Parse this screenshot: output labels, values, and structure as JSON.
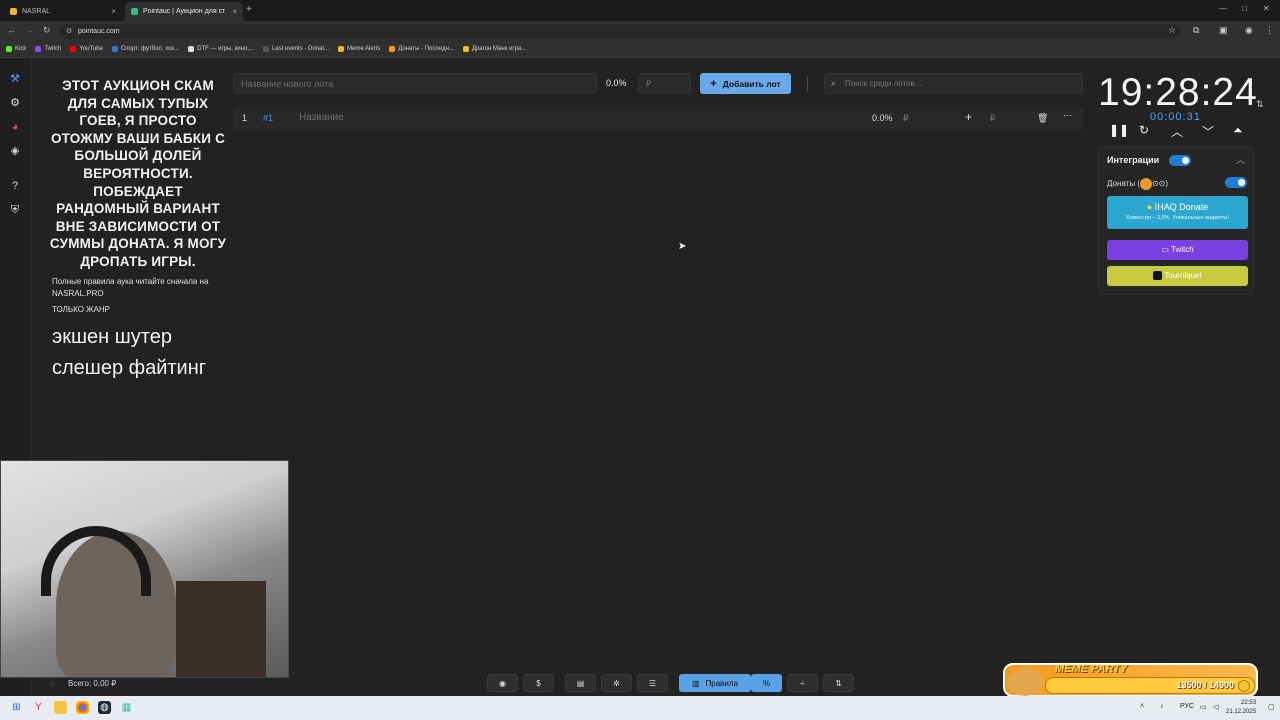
{
  "browser": {
    "tabs": [
      {
        "label": "NASRAL",
        "close": "×"
      },
      {
        "label": "Pointauc | Аукцион для стримеров",
        "close": "×"
      }
    ],
    "new_tab": "+",
    "window_controls": [
      "—",
      "□",
      "✕"
    ],
    "url": "pointauc.com",
    "bookmarks": [
      {
        "label": "Kick",
        "color": "#53fc18"
      },
      {
        "label": "Twitch",
        "color": "#9146ff"
      },
      {
        "label": "YouTube",
        "color": "#ff0000"
      },
      {
        "label": "Спорт: футбол, хок...",
        "color": "#2b7bd6"
      },
      {
        "label": "DTF — игры, кино,...",
        "color": "#dddddd"
      },
      {
        "label": "Last events - Donat...",
        "color": "#444444"
      },
      {
        "label": "Meme Alerts",
        "color": "#f0b429"
      },
      {
        "label": "Донаты - Последн...",
        "color": "#f59e0b"
      },
      {
        "label": "Драгон Манк игра...",
        "color": "#f6c200"
      }
    ]
  },
  "rules": {
    "headline": "ЭТОТ АУКЦИОН СКАМ ДЛЯ САМЫХ ТУПЫХ ГОЕВ, Я ПРОСТО ОТОЖМУ ВАШИ БАБКИ С БОЛЬШОЙ ДОЛЕЙ ВЕРОЯТНОСТИ. ПОБЕЖДАЕТ РАНДОМНЫЙ ВАРИАНТ ВНЕ ЗАВИСИМОСТИ ОТ СУММЫ ДОНАТА. Я МОГУ ДРОПАТЬ ИГРЫ.",
    "note_line1": "Полные правила аука читайте сначала на",
    "note_line2": "NASRAL.PRO",
    "note_line3": "ТОЛЬКО ЖАНР",
    "genre1": "экшен шутер",
    "genre2": "слешер файтинг"
  },
  "form": {
    "lot_placeholder": "Название нового лота",
    "percent": "0.0%",
    "currency": "₽",
    "add_label": "Добавить лот",
    "search_placeholder": "Поиск среди лотов..."
  },
  "lot": {
    "index": "1",
    "id": "#1",
    "name_placeholder": "Название",
    "percent": "0.0%",
    "currency": "₽"
  },
  "timer": {
    "main": "19:28:24",
    "sub": "00:00:31"
  },
  "integrations": {
    "title": "Интеграции",
    "donates_label": "Донаты (",
    "donates_suffix": "⊙⊙)",
    "ihaq_title": "IHAQ Donate",
    "ihaq_sub": "Комиссия – 3,5%. Уникальные виджеты!",
    "twitch": "Twitch",
    "tourniquet": "Tourniquet"
  },
  "footer": {
    "total": "Всего: 0,00 ₽",
    "rules_button": "Правила"
  },
  "meme": {
    "title": "MEME PARTY",
    "value": "13500 / 14900"
  },
  "taskbar": {
    "lang": "РУС",
    "time": "22:53",
    "date": "21.12.2025"
  }
}
